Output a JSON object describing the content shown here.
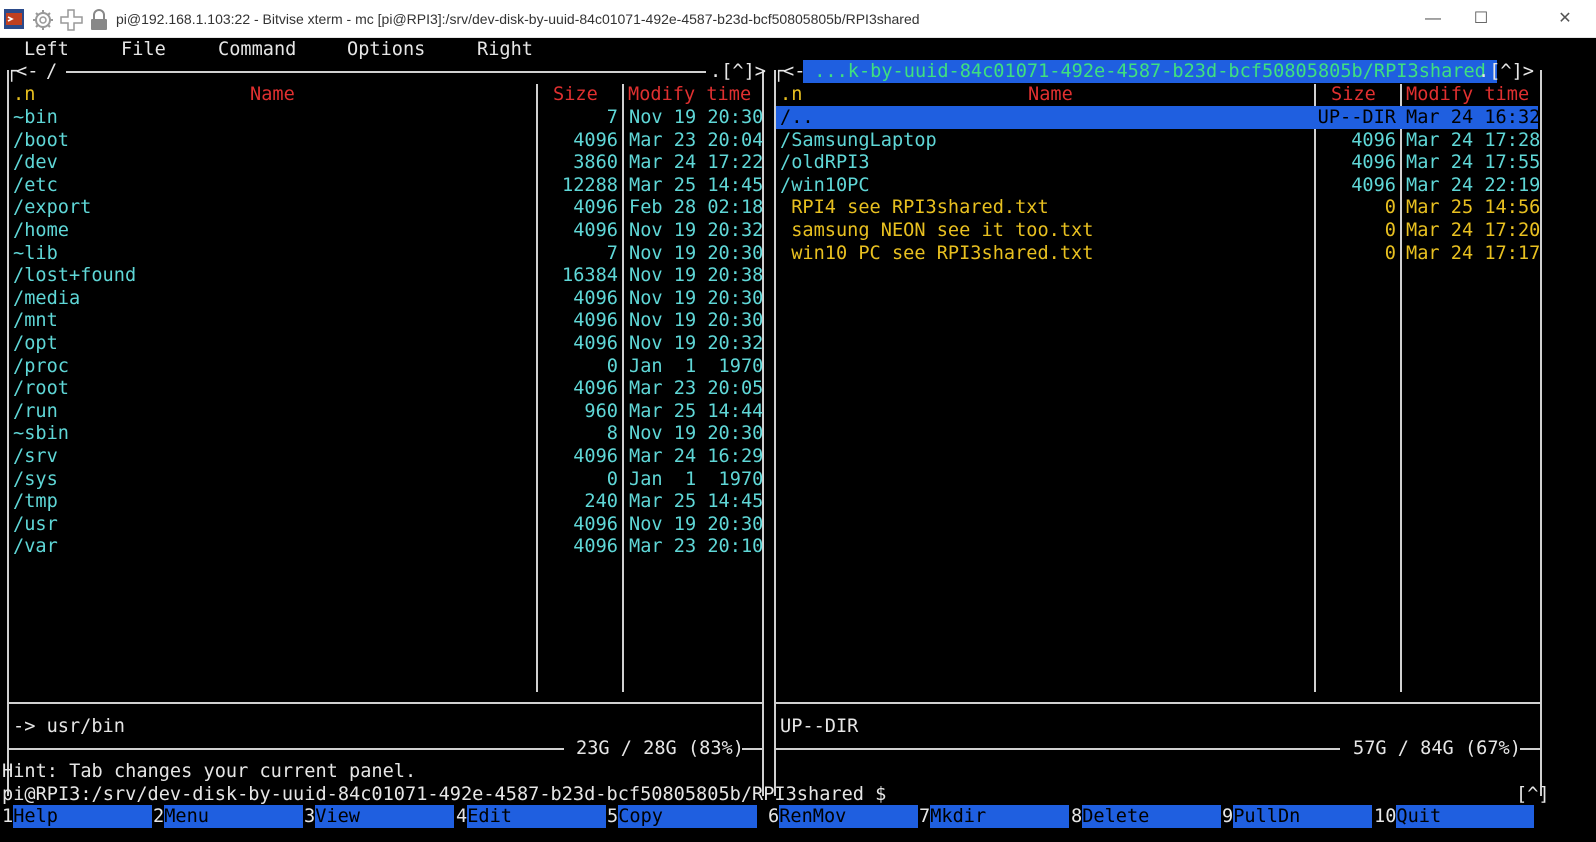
{
  "window": {
    "title": "pi@192.168.1.103:22 - Bitvise xterm - mc [pi@RPI3]:/srv/dev-disk-by-uuid-84c01071-492e-4587-b23d-bcf50805805b/RPI3shared",
    "minimize_glyph": "—",
    "maximize_glyph": "☐",
    "close_glyph": "✕"
  },
  "menu": [
    "Left",
    "File",
    "Command",
    "Options",
    "Right"
  ],
  "left_panel": {
    "path_prefix": "<- ",
    "path": "/",
    "corner": ".[^]>",
    "headers": {
      "sort": ".n",
      "name": "Name",
      "size": "Size",
      "mtime": "Modify time"
    },
    "files": [
      {
        "name": "~bin",
        "size": "7",
        "mtime": "Nov 19 20:30"
      },
      {
        "name": "/boot",
        "size": "4096",
        "mtime": "Mar 23 20:04"
      },
      {
        "name": "/dev",
        "size": "3860",
        "mtime": "Mar 24 17:22"
      },
      {
        "name": "/etc",
        "size": "12288",
        "mtime": "Mar 25 14:45"
      },
      {
        "name": "/export",
        "size": "4096",
        "mtime": "Feb 28 02:18"
      },
      {
        "name": "/home",
        "size": "4096",
        "mtime": "Nov 19 20:32"
      },
      {
        "name": "~lib",
        "size": "7",
        "mtime": "Nov 19 20:30"
      },
      {
        "name": "/lost+found",
        "size": "16384",
        "mtime": "Nov 19 20:38"
      },
      {
        "name": "/media",
        "size": "4096",
        "mtime": "Nov 19 20:30"
      },
      {
        "name": "/mnt",
        "size": "4096",
        "mtime": "Nov 19 20:30"
      },
      {
        "name": "/opt",
        "size": "4096",
        "mtime": "Nov 19 20:32"
      },
      {
        "name": "/proc",
        "size": "0",
        "mtime": "Jan  1  1970"
      },
      {
        "name": "/root",
        "size": "4096",
        "mtime": "Mar 23 20:05"
      },
      {
        "name": "/run",
        "size": "960",
        "mtime": "Mar 25 14:44"
      },
      {
        "name": "~sbin",
        "size": "8",
        "mtime": "Nov 19 20:30"
      },
      {
        "name": "/srv",
        "size": "4096",
        "mtime": "Mar 24 16:29"
      },
      {
        "name": "/sys",
        "size": "0",
        "mtime": "Jan  1  1970"
      },
      {
        "name": "/tmp",
        "size": "240",
        "mtime": "Mar 25 14:45"
      },
      {
        "name": "/usr",
        "size": "4096",
        "mtime": "Nov 19 20:30"
      },
      {
        "name": "/var",
        "size": "4096",
        "mtime": "Mar 23 20:10"
      }
    ],
    "status": "-> usr/bin",
    "disk": "23G / 28G (83%)"
  },
  "right_panel": {
    "path_prefix": "<-",
    "path": " ...k-by-uuid-84c01071-492e-4587-b23d-bcf50805805b/RPI3shared ",
    "corner": ".[^]>",
    "headers": {
      "sort": ".n",
      "name": "Name",
      "size": "Size",
      "mtime": "Modify time"
    },
    "files": [
      {
        "name": "/..",
        "size": "UP--DIR",
        "mtime": "Mar 24 16:32",
        "type": "selected"
      },
      {
        "name": "/SamsungLaptop",
        "size": "4096",
        "mtime": "Mar 24 17:28",
        "type": "dir"
      },
      {
        "name": "/oldRPI3",
        "size": "4096",
        "mtime": "Mar 24 17:55",
        "type": "dir"
      },
      {
        "name": "/win10PC",
        "size": "4096",
        "mtime": "Mar 24 22:19",
        "type": "dir"
      },
      {
        "name": " RPI4 see RPI3shared.txt",
        "size": "0",
        "mtime": "Mar 25 14:56",
        "type": "file"
      },
      {
        "name": " samsung NEON see it too.txt",
        "size": "0",
        "mtime": "Mar 24 17:20",
        "type": "file"
      },
      {
        "name": " win10 PC see RPI3shared.txt",
        "size": "0",
        "mtime": "Mar 24 17:17",
        "type": "file"
      }
    ],
    "status": "UP--DIR",
    "disk": "57G / 84G (67%)"
  },
  "hint": "Hint: Tab changes your current panel.",
  "prompt": "pi@RPI3:/srv/dev-disk-by-uuid-84c01071-492e-4587-b23d-bcf50805805b/RPI3shared $",
  "prompt_corner": "[^]",
  "fkeys": [
    {
      "num": "1",
      "label": "Help"
    },
    {
      "num": "2",
      "label": "Menu"
    },
    {
      "num": "3",
      "label": "View"
    },
    {
      "num": "4",
      "label": "Edit"
    },
    {
      "num": "5",
      "label": "Copy"
    },
    {
      "num": "6",
      "label": "RenMov"
    },
    {
      "num": "7",
      "label": "Mkdir"
    },
    {
      "num": "8",
      "label": "Delete"
    },
    {
      "num": "9",
      "label": "PullDn"
    },
    {
      "num": "10",
      "label": "Quit"
    }
  ],
  "colors": {
    "terminal_bg": "#000000",
    "dir_text": "#5fd7d7",
    "header_text": "#e03030",
    "file_text": "#e8c020",
    "selection_bg": "#1f5fe0",
    "frame": "#d0d0d0"
  }
}
